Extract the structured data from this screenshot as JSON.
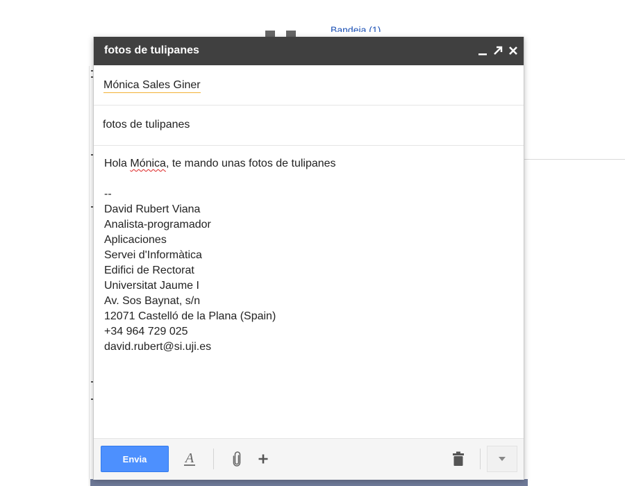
{
  "compose": {
    "title": "fotos de tulipanes",
    "to_recipient": "Mónica Sales Giner",
    "subject": "fotos de tulipanes",
    "body": {
      "greeting_prefix": "Hola ",
      "greeting_name": "Mónica",
      "greeting_suffix": ", te mando unas fotos de tulipanes",
      "separator": "--",
      "signature": [
        "David Rubert Viana",
        "Analista-programador",
        "Aplicaciones",
        "Servei d'Informàtica",
        "Edifici de Rectorat",
        "Universitat Jaume I",
        "Av. Sos Baynat, s/n",
        "12071 Castelló de la Plana (Spain)",
        "+34 964 729 025",
        "david.rubert@si.uji.es"
      ]
    },
    "toolbar": {
      "send_label": "Envia",
      "icons": [
        "format-text-icon",
        "attach-icon",
        "plus-icon",
        "trash-icon",
        "chevron-down-icon"
      ]
    }
  },
  "background": {
    "partial_link_text": "Bandeja (1)"
  },
  "colors": {
    "titlebar": "#404040",
    "send_button": "#4d90fe",
    "recipient_underline": "#f2b134"
  }
}
